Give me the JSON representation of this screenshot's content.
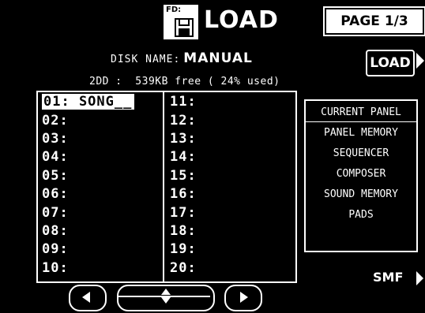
{
  "header": {
    "icon_tag": "FD:",
    "icon": "floppy-disk-icon",
    "title": "LOAD",
    "page": "PAGE 1/3"
  },
  "disk": {
    "name_label": "DISK NAME:",
    "name_value": "MANUAL",
    "info": "2DD :  539KB free ( 24% used)"
  },
  "load_button": {
    "label": "LOAD"
  },
  "slots": [
    "01: SONG__",
    "02:",
    "03:",
    "04:",
    "05:",
    "06:",
    "07:",
    "08:",
    "09:",
    "10:",
    "11:",
    "12:",
    "13:",
    "14:",
    "15:",
    "16:",
    "17:",
    "18:",
    "19:",
    "20:"
  ],
  "selected_slot": "01",
  "right_panel": {
    "items": [
      "CURRENT PANEL",
      "PANEL MEMORY",
      "SEQUENCER",
      "COMPOSER",
      "SOUND MEMORY",
      "PADS"
    ]
  },
  "smf": {
    "label": "SMF"
  },
  "nav": {
    "left": "arrow-left-icon",
    "mid": "up-down-arrows-icon",
    "right": "arrow-right-icon"
  }
}
